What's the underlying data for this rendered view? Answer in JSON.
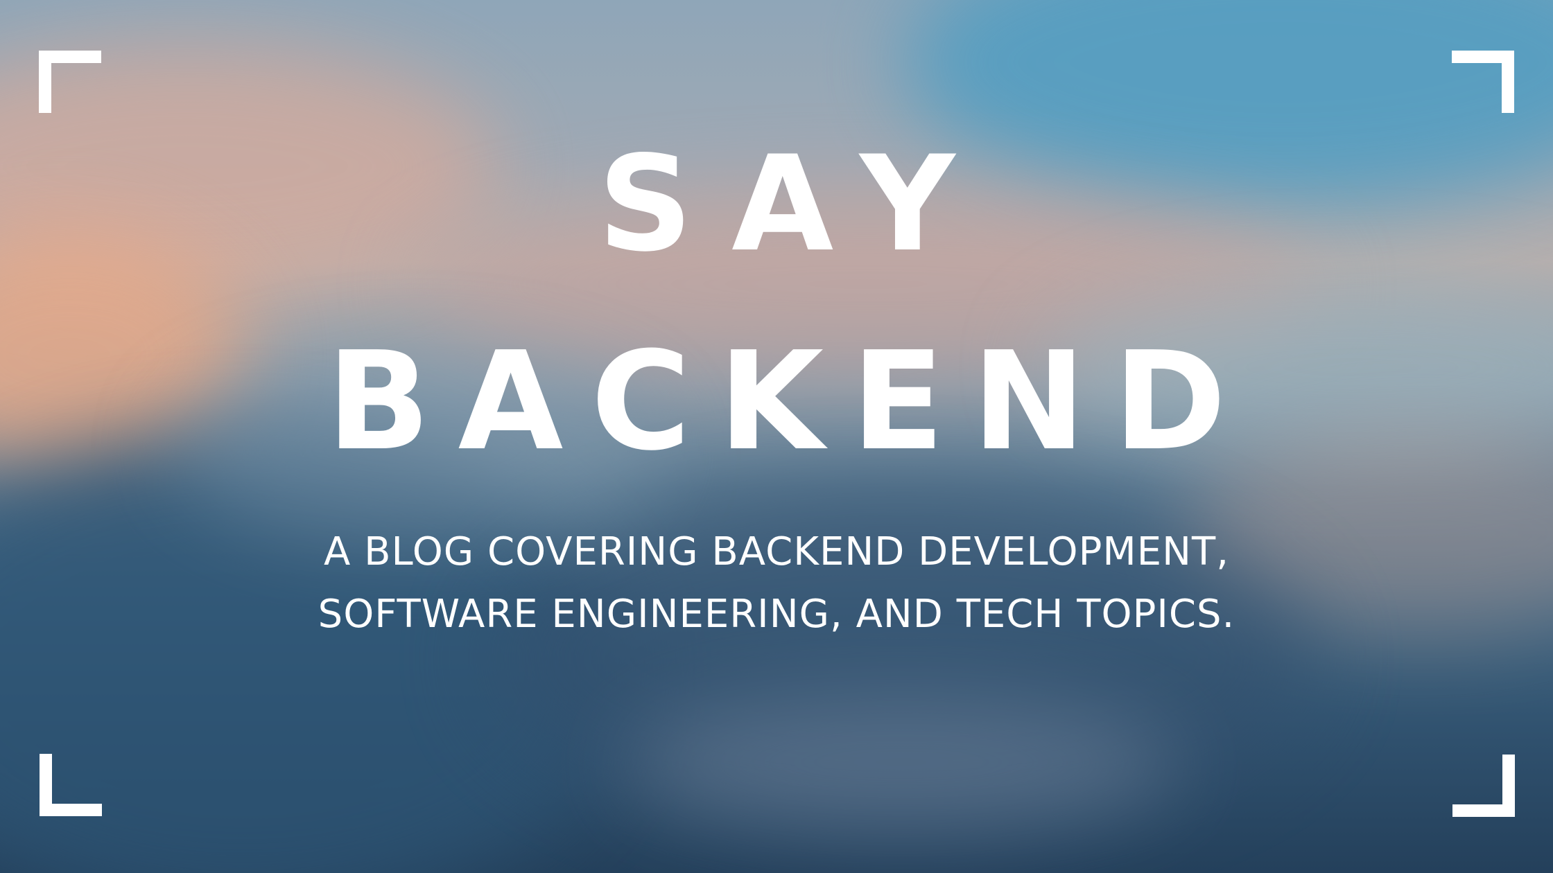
{
  "title": {
    "line1": "SAY",
    "line2": "BACKEND"
  },
  "tagline": {
    "line1": "A BLOG COVERING BACKEND DEVELOPMENT,",
    "line2": "SOFTWARE ENGINEERING, AND TECH TOPICS."
  },
  "colors": {
    "text": "#ffffff",
    "frame": "#ffffff",
    "sky_blue": "#4f9dc2",
    "sunset_peach": "#eaa986",
    "mountain_navy": "#2d5474"
  },
  "icons": [
    "corner-bracket-icon"
  ]
}
